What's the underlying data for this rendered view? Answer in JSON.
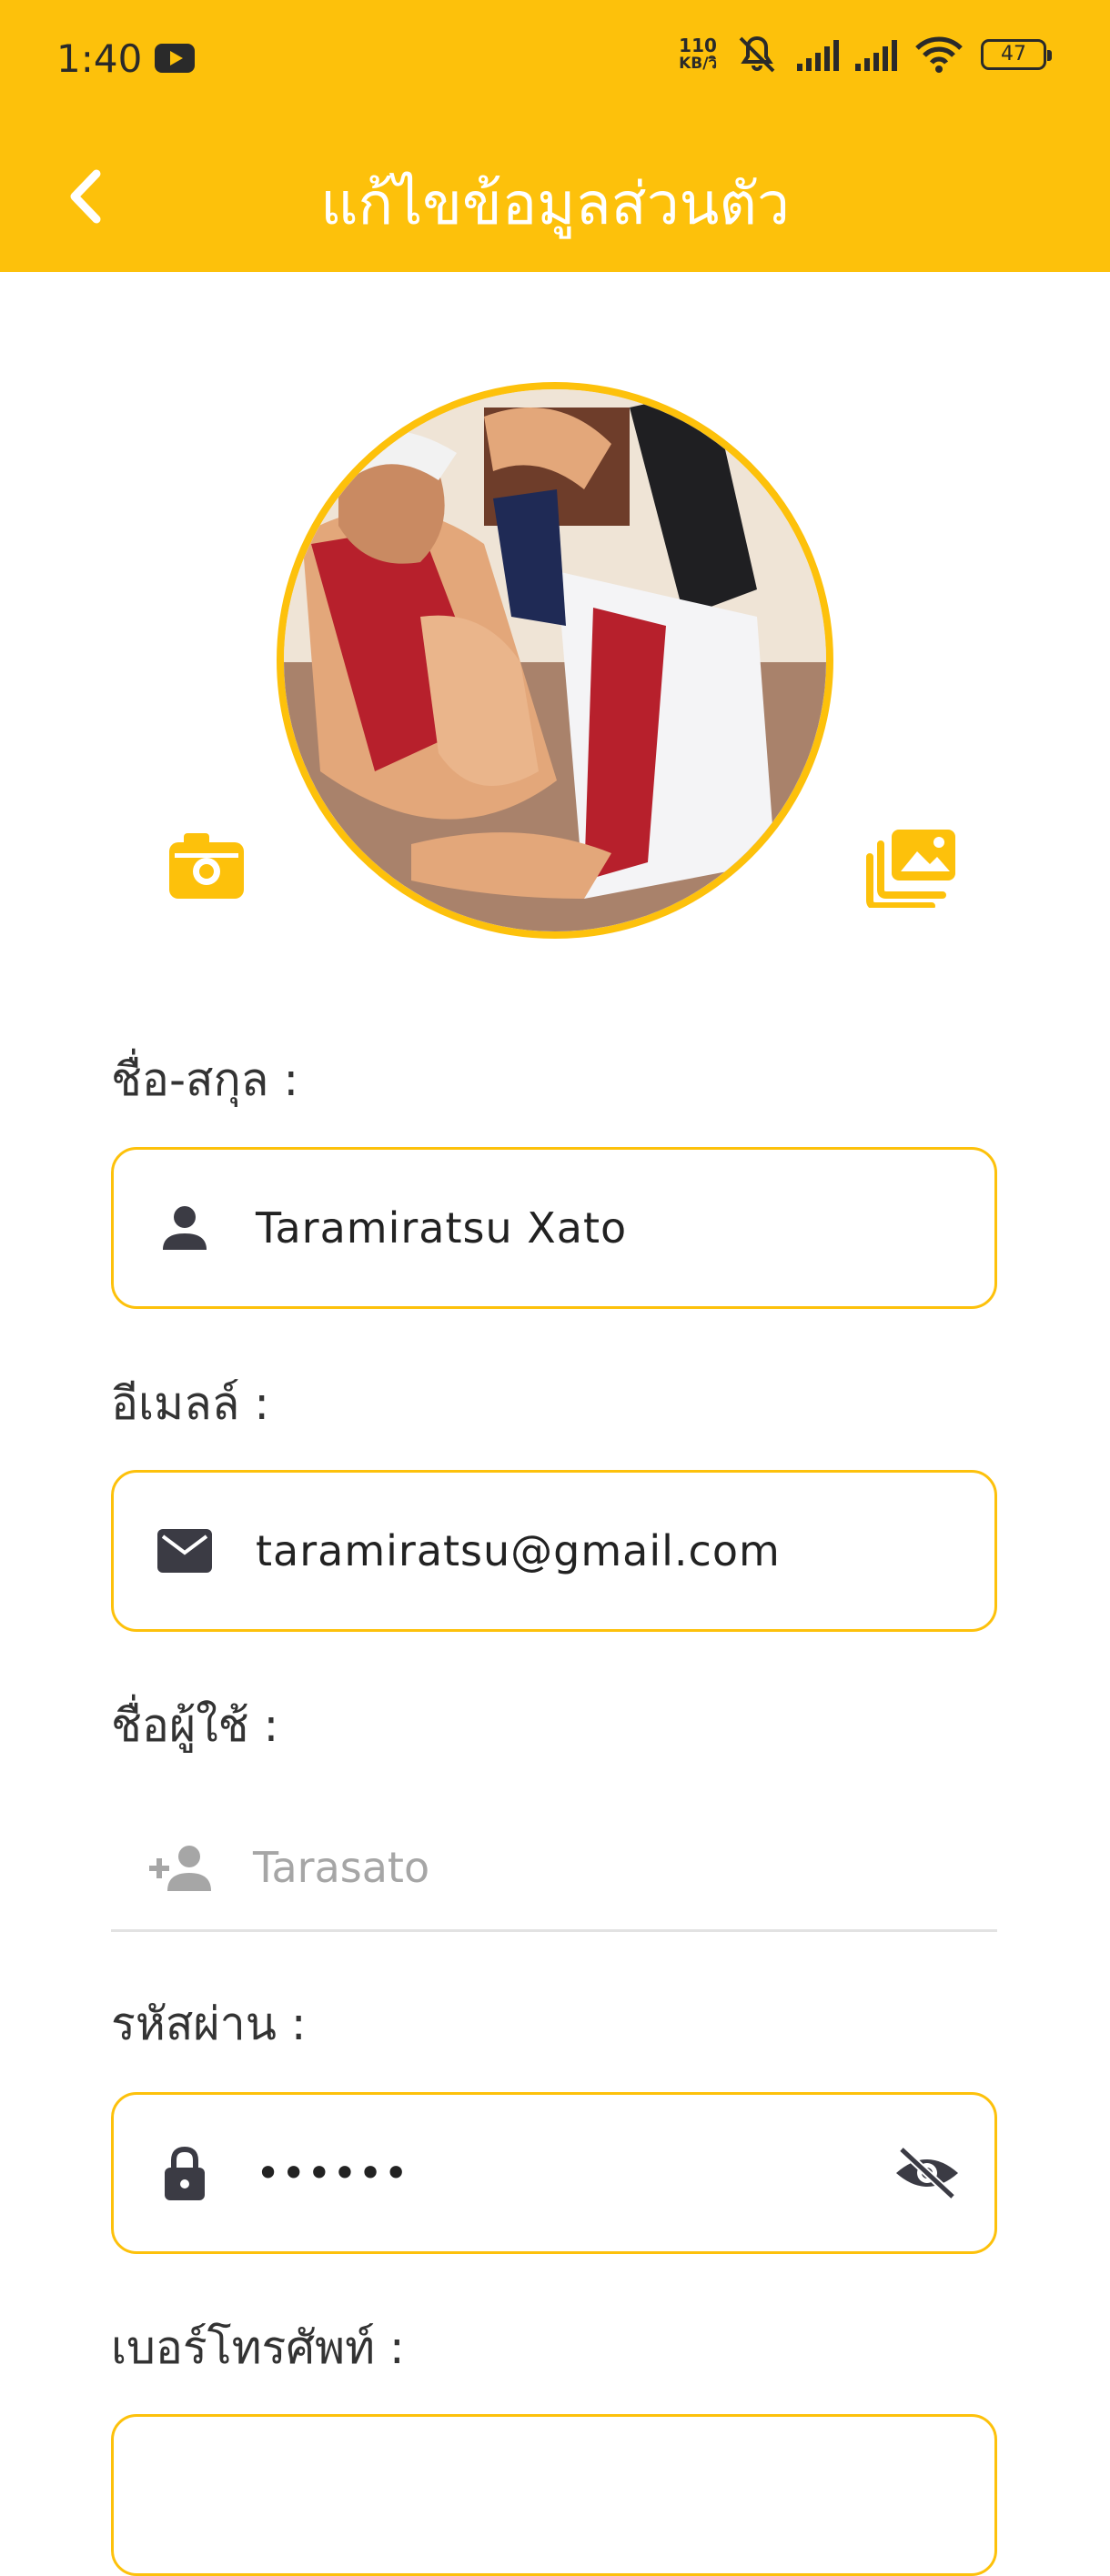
{
  "status_bar": {
    "time": "1:40",
    "net_speed_value": "110",
    "net_speed_unit": "KB/วิ",
    "battery": "47"
  },
  "header": {
    "title": "แก้ไขข้อมูลส่วนตัว"
  },
  "colors": {
    "accent": "#FDC10B",
    "icon_dark": "#3b3b44",
    "icon_muted": "#a6a6a6"
  },
  "form": {
    "fullname": {
      "label": "ชื่อ-สกุล :",
      "value": "Taramiratsu Xato",
      "icon": "person-icon"
    },
    "email": {
      "label": "อีเมลล์ :",
      "value": "taramiratsu@gmail.com",
      "icon": "mail-icon"
    },
    "username": {
      "label": "ชื่อผู้ใช้ :",
      "value": "Tarasato",
      "icon": "person-add-icon"
    },
    "password": {
      "label": "รหัสผ่าน :",
      "value": "••••••",
      "icon": "lock-icon",
      "toggle_icon": "eye-off-icon"
    },
    "phone": {
      "label": "เบอร์โทรศัพท์ :",
      "value": ""
    }
  }
}
